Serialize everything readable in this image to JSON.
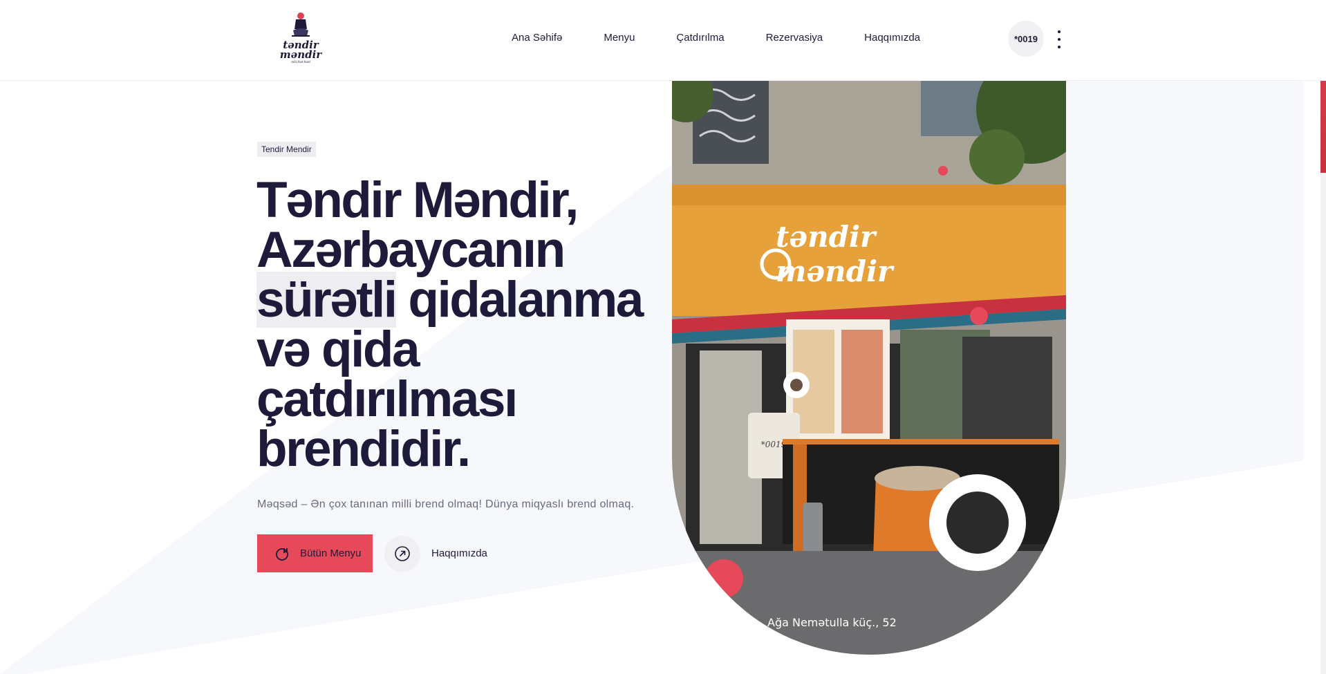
{
  "header": {
    "logo_text_top": "təndir",
    "logo_text_bottom": "məndir",
    "logo_tagline": "milli fast food",
    "nav": [
      "Ana Səhifə",
      "Menyu",
      "Çatdırılma",
      "Rezervasiya",
      "Haqqımızda"
    ],
    "phone": "*0019"
  },
  "hero": {
    "badge": "Tendir Mendir",
    "headline_line1": "Təndir Məndir,",
    "headline_line2": "Azərbaycanın",
    "headline_hl": "sürətli",
    "headline_line3_rest": " qidalanma",
    "headline_line4": "və qida",
    "headline_line5": "çatdırılması",
    "headline_line6": "brendidir.",
    "subtitle": "Məqsəd – Ən çox tanınan milli brend olmaq! Dünya miqyaslı brend olmaq.",
    "primary_button": "Bütün Menyu",
    "secondary_link": "Haqqımızda"
  },
  "photo": {
    "sign_top": "təndir",
    "sign_bottom": "məndir",
    "caption": "Ağa Nemətulla küç., 52",
    "poster_text": "*0019"
  },
  "colors": {
    "accent": "#e5495a",
    "text_dark": "#1e1b3a",
    "muted": "#6b6a80"
  }
}
